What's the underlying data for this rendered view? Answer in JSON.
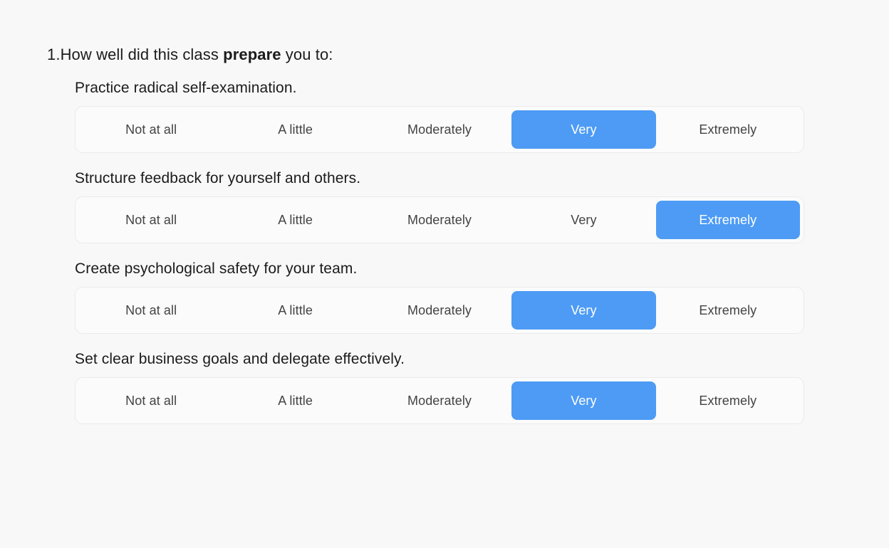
{
  "question": {
    "number": "1.",
    "text_before": "How well did this class ",
    "emphasis": "prepare",
    "text_after": " you to:"
  },
  "scale_options": [
    "Not at all",
    "A little",
    "Moderately",
    "Very",
    "Extremely"
  ],
  "colors": {
    "selected_background": "#4d9bf5",
    "selected_text": "#ffffff",
    "option_text": "#434343",
    "page_background": "#f8f8f8",
    "scale_background": "#fbfbfb",
    "scale_border": "#ebebeb",
    "heading_text": "#1b1b1b"
  },
  "items": [
    {
      "label": "Practice radical self-examination.",
      "selected": "Very",
      "selected_index": 3
    },
    {
      "label": "Structure feedback for yourself and others.",
      "selected": "Extremely",
      "selected_index": 4
    },
    {
      "label": "Create psychological safety for your team.",
      "selected": "Very",
      "selected_index": 3
    },
    {
      "label": "Set clear business goals and delegate effectively.",
      "selected": "Very",
      "selected_index": 3
    }
  ]
}
